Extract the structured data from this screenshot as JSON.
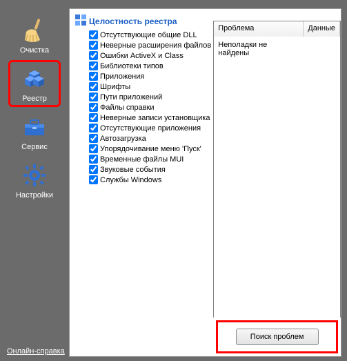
{
  "sidebar": {
    "items": [
      {
        "label": "Очистка"
      },
      {
        "label": "Реестр"
      },
      {
        "label": "Сервис"
      },
      {
        "label": "Настройки"
      }
    ],
    "selected_index": 1,
    "help_link": "Онлайн-справка"
  },
  "checklist": {
    "title": "Целостность реестра",
    "items": [
      {
        "label": "Отсутствующие общие DLL",
        "checked": true
      },
      {
        "label": "Неверные расширения файлов",
        "checked": true
      },
      {
        "label": "Ошибки ActiveX и Class",
        "checked": true
      },
      {
        "label": "Библиотеки типов",
        "checked": true
      },
      {
        "label": "Приложения",
        "checked": true
      },
      {
        "label": "Шрифты",
        "checked": true
      },
      {
        "label": "Пути приложений",
        "checked": true
      },
      {
        "label": "Файлы справки",
        "checked": true
      },
      {
        "label": "Неверные записи установщика",
        "checked": true
      },
      {
        "label": "Отсутствующие приложения",
        "checked": true
      },
      {
        "label": "Автозагрузка",
        "checked": true
      },
      {
        "label": "Упорядочивание меню 'Пуск'",
        "checked": true
      },
      {
        "label": "Временные файлы MUI",
        "checked": true
      },
      {
        "label": "Звуковые события",
        "checked": true
      },
      {
        "label": "Службы Windows",
        "checked": true
      }
    ]
  },
  "results": {
    "columns": [
      "Проблема",
      "Данные"
    ],
    "rows": [
      {
        "problem": "Неполадки не найдены",
        "data": ""
      }
    ]
  },
  "actions": {
    "scan_button": "Поиск проблем"
  }
}
